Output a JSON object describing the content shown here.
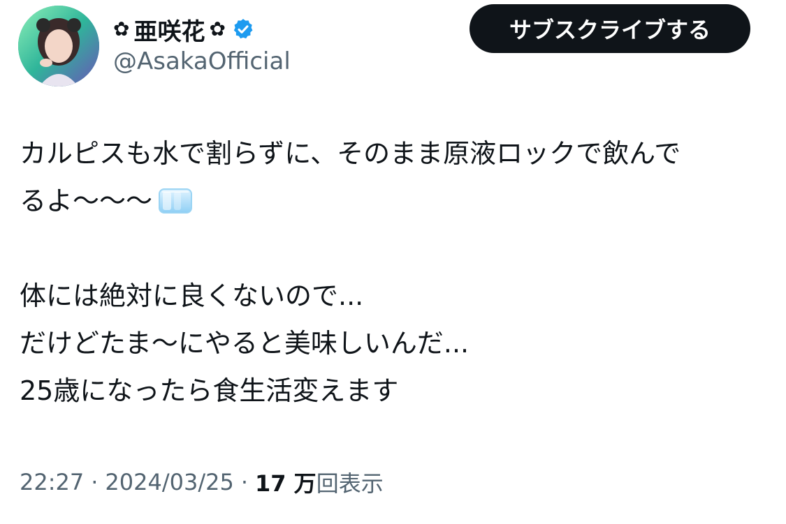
{
  "author": {
    "display_name": "亜咲花",
    "flower_left": "✿",
    "flower_right": "✿",
    "handle": "@AsakaOfficial",
    "verified_icon": "verified-badge-icon",
    "avatar_icon": "user-avatar"
  },
  "subscribe_button": {
    "label": "サブスクライブする"
  },
  "tweet": {
    "lines": [
      "カルピスも水で割らずに、そのまま原液ロックで飲んで",
      "るよ〜〜〜",
      "",
      "体には絶対に良くないので...",
      "だけどたま〜にやると美味しいんだ...",
      "25歳になったら食生活変えます"
    ],
    "emoji_icon": "ice-cube-icon"
  },
  "meta": {
    "time": "22:27",
    "separator": "·",
    "date": "2024/03/25",
    "views_count": "17 万",
    "views_label": "回表示"
  },
  "colors": {
    "text_primary": "#0f1419",
    "text_secondary": "#536471",
    "button_bg": "#0f1419",
    "verified": "#1d9bf0"
  }
}
